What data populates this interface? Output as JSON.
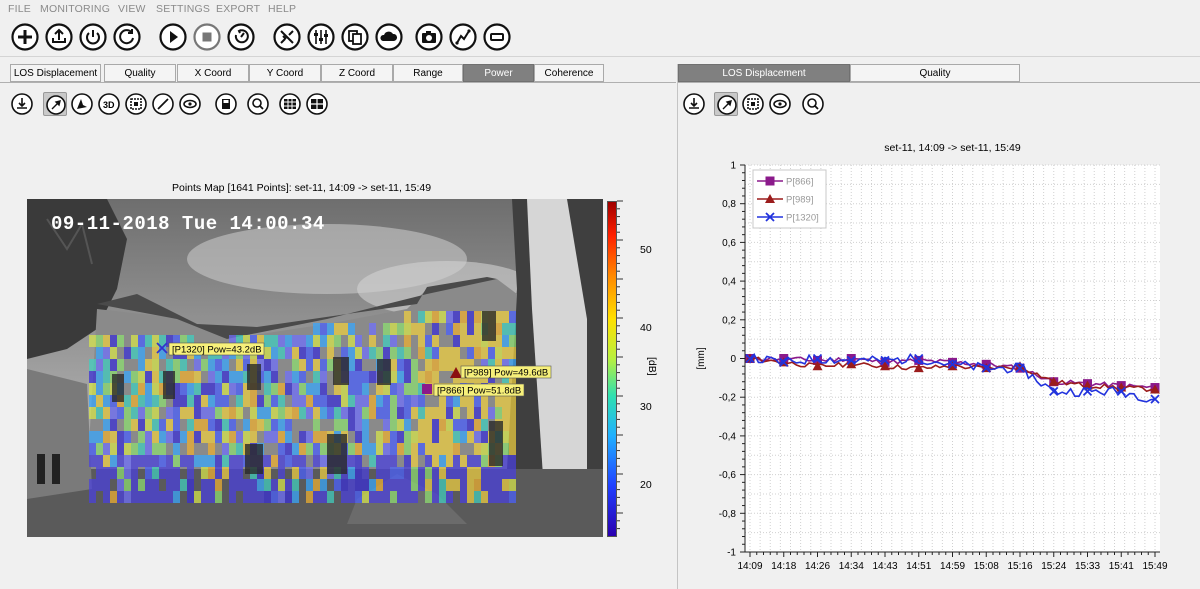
{
  "menu": [
    "FILE",
    "MONITORING",
    "VIEW",
    "SETTINGS",
    "EXPORT",
    "HELP"
  ],
  "toolbar_icons": [
    "add-icon",
    "upload-icon",
    "power-icon",
    "refresh-icon",
    "play-icon",
    "stop-icon",
    "power-cycle-icon",
    "satellite-icon",
    "sliders-icon",
    "copy-icon",
    "cloud-icon",
    "camera-icon",
    "route-icon",
    "minus-icon"
  ],
  "left_tabs": [
    {
      "label": "LOS Displacement",
      "active": false
    },
    {
      "label": "Quality",
      "active": false
    },
    {
      "label": "X Coord",
      "active": false
    },
    {
      "label": "Y Coord",
      "active": false
    },
    {
      "label": "Z Coord",
      "active": false
    },
    {
      "label": "Range",
      "active": false
    },
    {
      "label": "Power",
      "active": true
    },
    {
      "label": "Coherence",
      "active": false
    }
  ],
  "right_tabs": [
    {
      "label": "LOS Displacement",
      "active": true
    },
    {
      "label": "Quality",
      "active": false
    }
  ],
  "left_tools": [
    "download-icon",
    "pointer-icon",
    "navigate-icon",
    "3d-view-icon",
    "select-box-icon",
    "line-icon",
    "eye-icon",
    "save-icon",
    "zoom-icon",
    "grid-icon-a",
    "grid-icon-b"
  ],
  "right_tools": [
    "download-icon",
    "pointer-icon",
    "select-box-icon",
    "eye-icon",
    "zoom-icon"
  ],
  "map": {
    "title": "Points Map [1641 Points]: set-11, 14:09 -> set-11, 15:49",
    "timestamp": "09-11-2018 Tue 14:00:34",
    "colorbar": {
      "label": "[dB]",
      "ticks": [
        "50",
        "40",
        "30",
        "20"
      ],
      "min": 15,
      "max": 55
    },
    "points": [
      {
        "id": "P1320",
        "label": "[P1320] Pow=43.2dB",
        "marker": "cross",
        "color": "#3333cc"
      },
      {
        "id": "P989",
        "label": "[P989] Pow=49.6dB",
        "marker": "triangle",
        "color": "#8b1010"
      },
      {
        "id": "P866",
        "label": "[P866] Pow=51.8dB",
        "marker": "square",
        "color": "#8b1a8b"
      }
    ]
  },
  "chart_data": {
    "type": "line",
    "title": "set-11, 14:09 -> set-11, 15:49",
    "ylabel": "[mm]",
    "xlabel": "",
    "ylim": [
      -1,
      1
    ],
    "yticks": [
      "1",
      "0,8",
      "0,6",
      "0,4",
      "0,2",
      "0",
      "-0,2",
      "-0,4",
      "-0,6",
      "-0,8",
      "-1"
    ],
    "x": [
      "14:09",
      "14:18",
      "14:26",
      "14:34",
      "14:43",
      "14:51",
      "14:59",
      "15:08",
      "15:16",
      "15:24",
      "15:33",
      "15:41",
      "15:49"
    ],
    "legend_position": "top-left",
    "series": [
      {
        "name": "P[866]",
        "color": "#8b1a8b",
        "marker": "square",
        "values": [
          0.0,
          0.0,
          -0.01,
          0.0,
          -0.02,
          -0.01,
          -0.02,
          -0.03,
          -0.05,
          -0.12,
          -0.13,
          -0.14,
          -0.15
        ]
      },
      {
        "name": "P[989]",
        "color": "#9b1c1c",
        "marker": "triangle",
        "values": [
          0.0,
          -0.02,
          -0.04,
          -0.03,
          -0.04,
          -0.05,
          -0.04,
          -0.05,
          -0.04,
          -0.12,
          -0.14,
          -0.15,
          -0.16
        ]
      },
      {
        "name": "P[1320]",
        "color": "#2233dd",
        "marker": "cross",
        "values": [
          0.0,
          -0.02,
          0.0,
          -0.01,
          -0.01,
          0.0,
          -0.03,
          -0.05,
          -0.05,
          -0.17,
          -0.17,
          -0.17,
          -0.21
        ]
      }
    ]
  }
}
